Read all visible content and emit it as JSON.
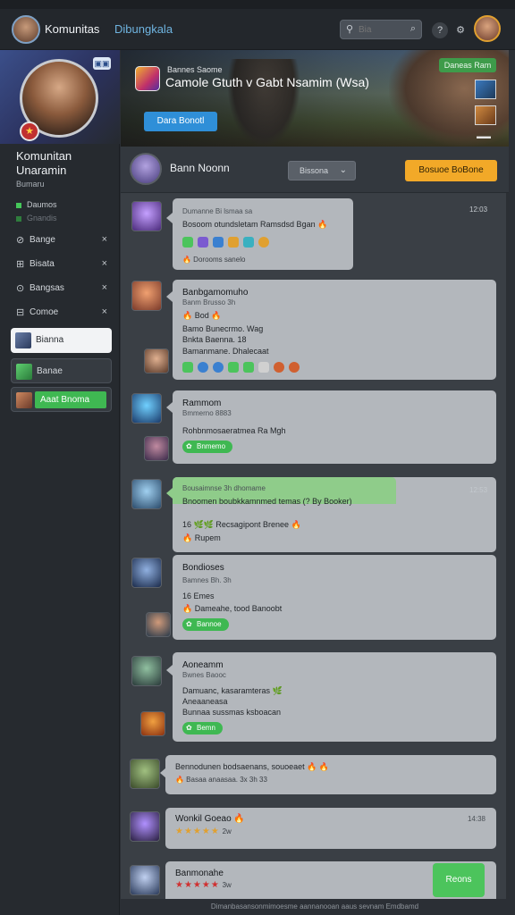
{
  "topbar": {
    "app_name": "Komunitas",
    "app_sub": "Dibungkala",
    "search_value": "",
    "search_placeholder": "Bia",
    "icons": [
      "search-icon",
      "magnifier-icon",
      "help-icon",
      "settings-icon"
    ]
  },
  "sidebar": {
    "corner_label": "▣▣",
    "name": "Komunitan Unaramin",
    "sub": "Bumaru",
    "status": [
      {
        "label": "Daumos",
        "active": true
      },
      {
        "label": "Gnandis",
        "active": false
      }
    ],
    "nav": [
      {
        "icon": "⊘",
        "label": "Bange"
      },
      {
        "icon": "⊞",
        "label": "Bisata"
      },
      {
        "icon": "⊙",
        "label": "Bangsas"
      },
      {
        "icon": "⊟",
        "label": "Comoe"
      }
    ],
    "cards": [
      {
        "label": "Bianna"
      },
      {
        "label": "Banae"
      },
      {
        "label": "Aaat Bnoma"
      }
    ]
  },
  "hero": {
    "kicker": "Bannes Saome",
    "title": "Camole Gtuth v Gabt Nsamim (Wsa)",
    "button": "Dara Bonotl",
    "online": "Daneas Ram"
  },
  "room": {
    "name": "Bann Noonn",
    "button": "Bissona",
    "cta": "Bosuoe BoBone"
  },
  "messages": [
    {
      "meta": "Dumanne Bi lsmaa sa",
      "time": "12:03",
      "line1": "Bosoom otundsletam Ramsdsd Bgan 🔥",
      "footer": "🔥 Dorooms sanelo"
    },
    {
      "name": "Banbgamomuho",
      "meta": "Banm Brusso 3h",
      "line1": "🔥 Bod 🔥",
      "line2": "Bamo Bunecrmo. Wag",
      "line3": "Bnkta Baenna. 18",
      "line4": "Bamanmane. Dhalecaat"
    },
    {
      "name": "Rammom",
      "meta": "Bmmerno 8883",
      "line1": "Rohbnmosaeratmea Ra Mgh",
      "pill": "Bnmemo"
    },
    {
      "meta": "Bousaimnse 3h dhomame",
      "time": "12:53",
      "line1": "Bnoomen boubkkamnmed temas (? By Booker)",
      "line2": "16 🌿🌿 Recsagipont Brenee 🔥",
      "line3": "🔥 Rupem"
    },
    {
      "name": "Bondioses",
      "meta": "Bamnes Bh. 3h",
      "line1": "16 Emes",
      "line2": "🔥 Dameahe, tood Banoobt",
      "pill": "Bannoe"
    },
    {
      "name": "Aoneamm",
      "meta": "Bwnes Baooc",
      "line1": "Damuanc, kasaramteras 🌿",
      "line2": "Aneaaneasa",
      "line3": "Bunnaa sussmas ksboacan",
      "pill": "Bemn"
    },
    {
      "line1": "Bennodunen bodsaenans, souoeaet 🔥 🔥",
      "meta": "🔥 Basaa anaasaa. 3x 3h 33"
    },
    {
      "name": "Wonkil",
      "name_tail": "Goeao 🔥",
      "time": "14:38",
      "stars": "★★★★★",
      "stars_note": "2w"
    },
    {
      "name": "Banmonahe",
      "stars": "★★★★★",
      "stars_note": "3w",
      "reply": "Reons"
    }
  ],
  "footer": "Dimanbasansonmimoesme aannanooan aaus sevnam Emdbamd",
  "colors": {
    "accent_green": "#3fb852",
    "accent_orange": "#f2a928",
    "accent_blue": "#2f8fd8",
    "bubble": "#b3b7bc",
    "bubble_green": "#8fcc8a"
  }
}
